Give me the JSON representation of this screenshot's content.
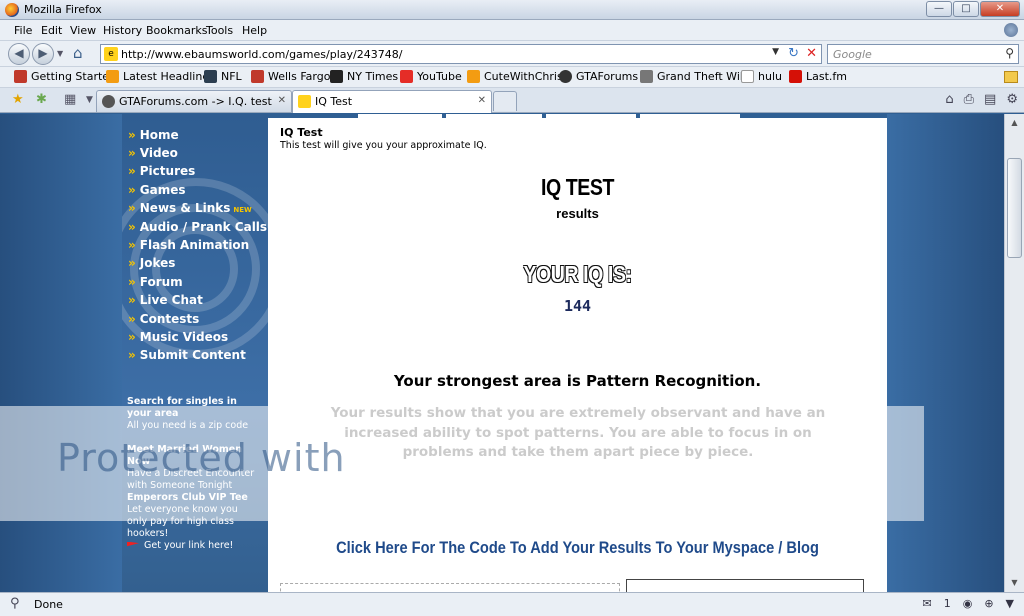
{
  "window": {
    "title": "Mozilla Firefox"
  },
  "menu": [
    "File",
    "Edit",
    "View",
    "History",
    "Bookmarks",
    "Tools",
    "Help"
  ],
  "navigation": {
    "url": "http://www.ebaumsworld.com/games/play/243748/",
    "search_placeholder": "Google"
  },
  "bookmarks": [
    {
      "label": "Getting Started",
      "color": "#c0392b"
    },
    {
      "label": "Latest Headlines",
      "color": "#f39c12"
    },
    {
      "label": "NFL",
      "color": "#2c3e50"
    },
    {
      "label": "Wells Fargo",
      "color": "#c0392b"
    },
    {
      "label": "NY Times",
      "color": "#222222"
    },
    {
      "label": "YouTube",
      "color": "#e52d27"
    },
    {
      "label": "CuteWithChris",
      "color": "#f39c12"
    },
    {
      "label": "GTAForums",
      "color": "#333333"
    },
    {
      "label": "Grand Theft Wiki",
      "color": "#555555"
    },
    {
      "label": "hulu",
      "color": "#cccccc"
    },
    {
      "label": "Last.fm",
      "color": "#d51007"
    }
  ],
  "tabs": [
    {
      "label": "GTAForums.com -> I.Q. test",
      "active": false
    },
    {
      "label": "IQ Test",
      "active": true
    }
  ],
  "sidebar": {
    "links": [
      "Home",
      "Video",
      "Pictures",
      "Games",
      "News & Links",
      "Audio / Prank Calls",
      "Flash Animation",
      "Jokes",
      "Forum",
      "Live Chat",
      "Contests",
      "Music Videos",
      "Submit Content"
    ],
    "new_badge": "NEW",
    "ads": [
      {
        "title": "Search for singles in your area",
        "body": "All you need is a zip code"
      },
      {
        "title": "Meet Married Women Now",
        "body": "Have a Discreet Encounter with Someone Tonight"
      },
      {
        "title": "Emperors Club VIP Tee",
        "body": "Let everyone know you only pay for high class hookers!"
      }
    ],
    "get_link": "Get your link here!"
  },
  "content": {
    "title": "IQ Test",
    "subtitle": "This test will give you your approximate IQ.",
    "heading": "IQ TEST",
    "results_label": "results",
    "your_iq_label": "YOUR IQ IS:",
    "score": "144",
    "strongest_area": "Your strongest area is Pattern Recognition.",
    "description": "Your results show that you are extremely observant and have an increased ability to spot patterns.  You are able to focus in on problems and take them apart piece by piece.",
    "cta": "Click Here For The Code To Add Your Results To Your Myspace / Blog"
  },
  "watermark": {
    "text": "Protected with"
  },
  "status": {
    "text": "Done",
    "count": "1"
  }
}
